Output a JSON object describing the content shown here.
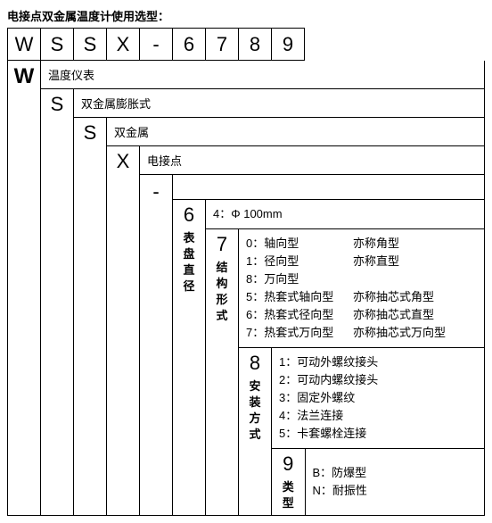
{
  "title": "电接点双金属温度计使用选型：",
  "code": [
    "W",
    "S",
    "S",
    "X",
    "-",
    "6",
    "7",
    "8",
    "9"
  ],
  "levels": {
    "W": {
      "letter": "W",
      "label": "温度仪表"
    },
    "S1": {
      "letter": "S",
      "label": "双金属膨胀式"
    },
    "S2": {
      "letter": "S",
      "label": "双金属"
    },
    "X": {
      "letter": "X",
      "label": "电接点"
    },
    "dash": {
      "letter": "-"
    }
  },
  "d6": {
    "digit": "6",
    "vlabel": "表盘直径",
    "desc_line": "4：Φ 100mm"
  },
  "d7": {
    "digit": "7",
    "vlabel": "结构形式",
    "lines": [
      {
        "a": "0：轴向型",
        "b": "亦称角型"
      },
      {
        "a": "1：径向型",
        "b": "亦称直型"
      },
      {
        "a": "8：万向型",
        "b": ""
      },
      {
        "a": "5：热套式轴向型",
        "b": "亦称抽芯式角型"
      },
      {
        "a": "6：热套式径向型",
        "b": "亦称抽芯式直型"
      },
      {
        "a": "7：热套式万向型",
        "b": "亦称抽芯式万向型"
      }
    ]
  },
  "d8": {
    "digit": "8",
    "vlabel": "安装方式",
    "lines": [
      "1：可动外螺纹接头",
      "2：可动内螺纹接头",
      "3：固定外螺纹",
      "4：法兰连接",
      "5：卡套螺栓连接"
    ]
  },
  "d9": {
    "digit": "9",
    "vlabel": "类型",
    "lines": [
      "B：防爆型",
      "N：耐振性"
    ]
  }
}
